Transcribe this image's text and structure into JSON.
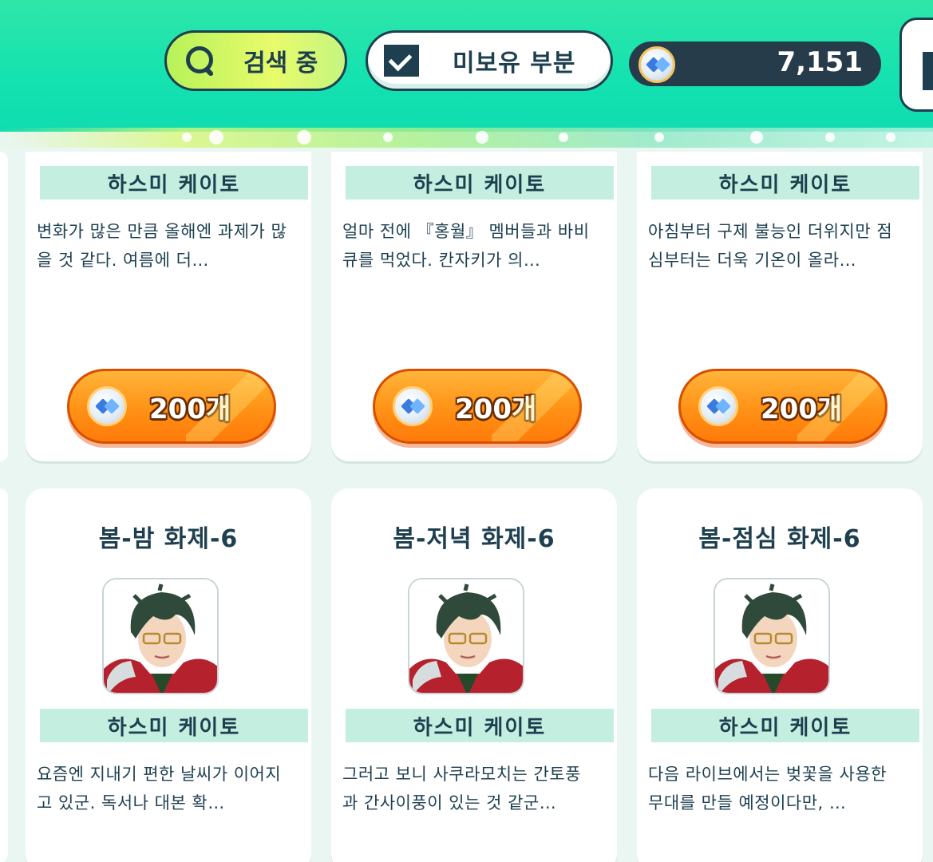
{
  "header": {
    "search_label": "검색 중",
    "filter_label": "미보유 부분",
    "filter_checked": true,
    "currency_value": "7,151",
    "colors": {
      "header": "#14e2b0",
      "dark": "#1d3f4f",
      "accent": "#ff9216"
    }
  },
  "cards_top": [
    {
      "name": "하스미 케이토",
      "desc_line1": "변화가 많은 만큼 올해엔 과제가 많",
      "desc_line2": "을 것 같다. 여름에 더…",
      "price": "200개"
    },
    {
      "name": "하스미 케이토",
      "desc_line1": "얼마 전에 『홍월』 멤버들과 바비",
      "desc_line2": "큐를 먹었다. 칸자키가 의…",
      "price": "200개"
    },
    {
      "name": "하스미 케이토",
      "desc_line1": "아침부터 구제 불능인 더위지만 점",
      "desc_line2": "심부터는 더욱 기온이 올라…",
      "price": "200개"
    }
  ],
  "cards_bottom": [
    {
      "title": "봄-밤 화제-6",
      "name": "하스미 케이토",
      "desc_line1": "요즘엔 지내기 편한 날씨가 이어지",
      "desc_line2": "고 있군. 독서나 대본 확…"
    },
    {
      "title": "봄-저녁 화제-6",
      "name": "하스미 케이토",
      "desc_line1": "그러고 보니 사쿠라모치는 간토풍",
      "desc_line2": "과 간사이풍이 있는 것 같군…"
    },
    {
      "title": "봄-점심 화제-6",
      "name": "하스미 케이토",
      "desc_line1": "다음 라이브에서는 벚꽃을 사용한",
      "desc_line2": "무대를 만들 예정이다만, …"
    }
  ]
}
